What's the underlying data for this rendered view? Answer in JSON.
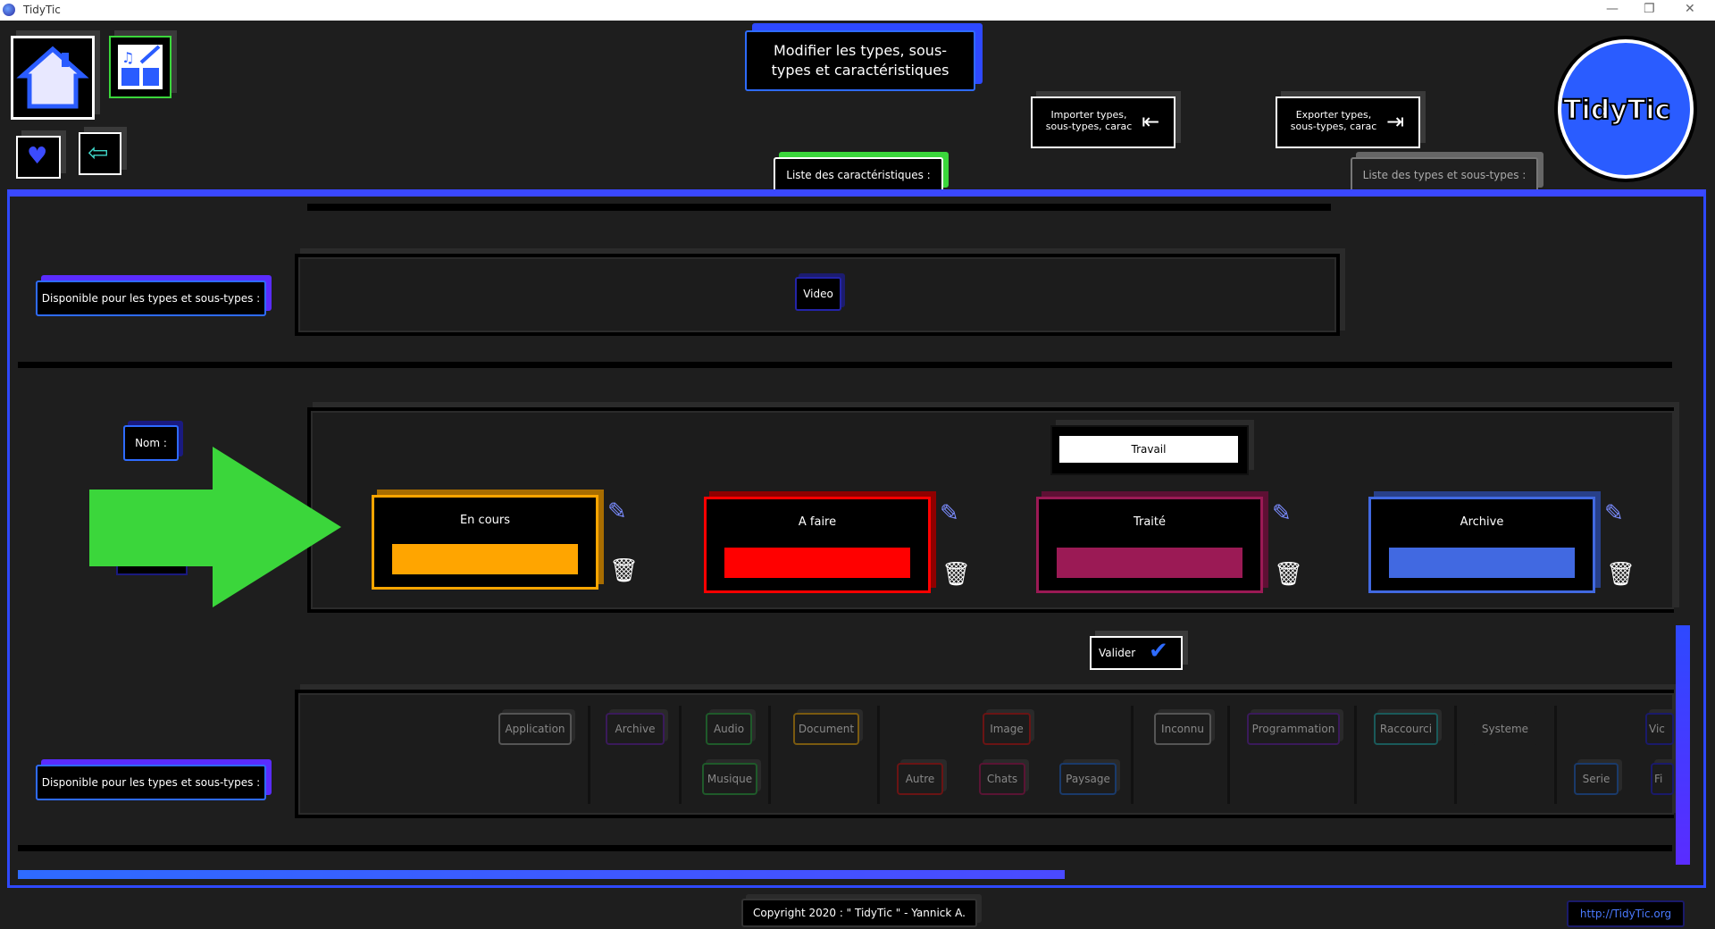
{
  "window": {
    "title": "TidyTic",
    "minimize": "—",
    "restore": "❐",
    "close": "✕"
  },
  "header": {
    "title": "Modifier les types, sous-types et caractéristiques",
    "import_label": "Importer types, sous-types, carac",
    "export_label": "Exporter types, sous-types, carac",
    "tab_characteristics": "Liste des caractéristiques :",
    "tab_types": "Liste des types et sous-types :",
    "logo_text": "TidyTic"
  },
  "panel_top": {
    "label": "Disponible pour les types et sous-types :",
    "tag": "Video"
  },
  "editor": {
    "name_label": "Nom :",
    "name_value": "Travail",
    "statuses": [
      {
        "name": "En cours",
        "color": "#ffa500"
      },
      {
        "name": "A faire",
        "color": "#ff0000"
      },
      {
        "name": "Traité",
        "color": "#9b1a55"
      },
      {
        "name": "Archive",
        "color": "#4169e1"
      }
    ],
    "validate_label": "Valider"
  },
  "panel_bottom": {
    "label": "Disponible pour les types et sous-types :",
    "tags_row1": [
      "Application",
      "Archive",
      "Audio",
      "Document",
      "Image",
      "Inconnu",
      "Programmation",
      "Raccourci",
      "Systeme",
      "Vic"
    ],
    "tags_row2": [
      "Musique",
      "Autre",
      "Chats",
      "Paysage",
      "Serie",
      "Fi"
    ]
  },
  "footer": {
    "copyright": "Copyright 2020 : \" TidyTic \" - Yannick A.",
    "url": "http://TidyTic.org"
  },
  "colors": {
    "accent_blue": "#2e6bff",
    "accent_purple": "#6a2cff",
    "green": "#3bd63b"
  }
}
